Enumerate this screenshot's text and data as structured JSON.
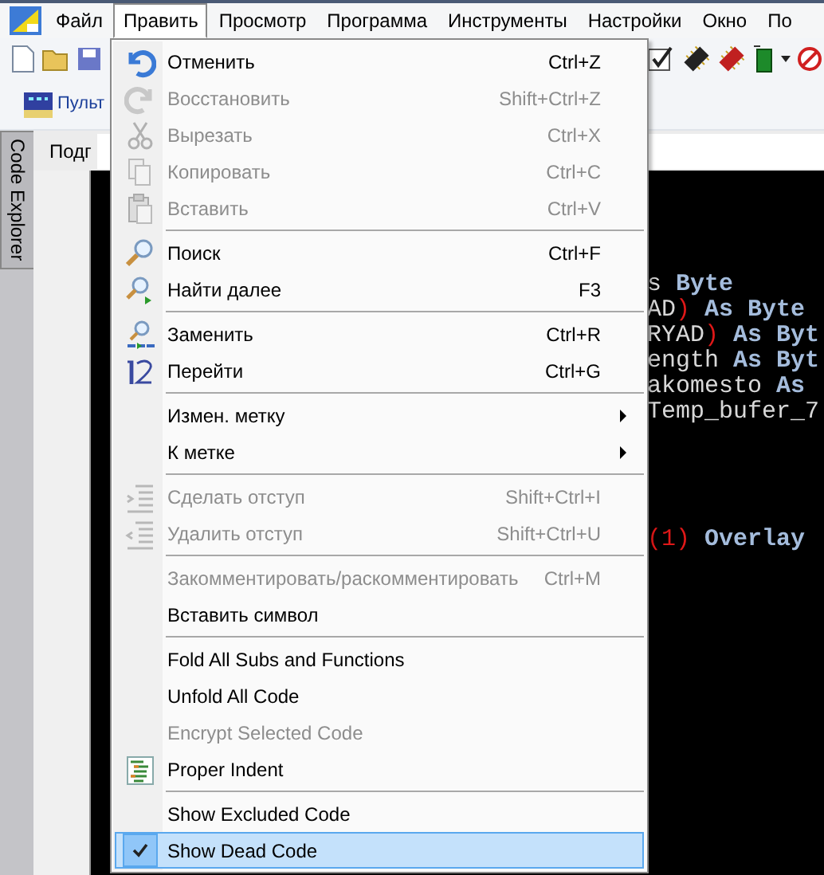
{
  "menubar": [
    {
      "label": "Файл",
      "selected": false
    },
    {
      "label": "Править",
      "selected": true
    },
    {
      "label": "Просмотр",
      "selected": false
    },
    {
      "label": "Программа",
      "selected": false
    },
    {
      "label": "Инструменты",
      "selected": false
    },
    {
      "label": "Настройки",
      "selected": false
    },
    {
      "label": "Окно",
      "selected": false
    },
    {
      "label": "По",
      "selected": false
    }
  ],
  "panel_button": {
    "label": "Пульт"
  },
  "doc_tab": {
    "label": "Подг"
  },
  "side_tab": {
    "label": "Code Explorer"
  },
  "code_block_upper": [
    [
      {
        "kind": "text",
        "text": "s "
      },
      {
        "kind": "keyword",
        "text": "Byte"
      }
    ],
    [
      {
        "kind": "text",
        "text": "AD"
      },
      {
        "kind": "paren",
        "text": ")"
      },
      {
        "kind": "keyword",
        "text": " As Byte"
      }
    ],
    [
      {
        "kind": "text",
        "text": "RYAD"
      },
      {
        "kind": "paren",
        "text": ")"
      },
      {
        "kind": "keyword",
        "text": " As Byt"
      }
    ],
    [
      {
        "kind": "text",
        "text": "ength "
      },
      {
        "kind": "keyword",
        "text": "As Byt"
      }
    ],
    [
      {
        "kind": "text",
        "text": "akomesto "
      },
      {
        "kind": "keyword",
        "text": "As"
      }
    ],
    [
      {
        "kind": "text",
        "text": "Temp_bufer_7"
      }
    ]
  ],
  "code_block_lower": [
    [
      {
        "kind": "paren",
        "text": "(1)"
      },
      {
        "kind": "keyword",
        "text": " Overlay"
      }
    ]
  ],
  "menu": {
    "groups": [
      [
        {
          "label": "Отменить",
          "shortcut": "Ctrl+Z",
          "disabled": false,
          "submenu": false,
          "checked": false,
          "selected": false
        },
        {
          "label": "Восстановить",
          "shortcut": "Shift+Ctrl+Z",
          "disabled": true,
          "submenu": false,
          "checked": false,
          "selected": false
        },
        {
          "label": "Вырезать",
          "shortcut": "Ctrl+X",
          "disabled": true,
          "submenu": false,
          "checked": false,
          "selected": false
        },
        {
          "label": "Копировать",
          "shortcut": "Ctrl+C",
          "disabled": true,
          "submenu": false,
          "checked": false,
          "selected": false
        },
        {
          "label": "Вставить",
          "shortcut": "Ctrl+V",
          "disabled": true,
          "submenu": false,
          "checked": false,
          "selected": false
        }
      ],
      [
        {
          "label": "Поиск",
          "shortcut": "Ctrl+F",
          "disabled": false,
          "submenu": false,
          "checked": false,
          "selected": false
        },
        {
          "label": "Найти далее",
          "shortcut": "F3",
          "disabled": false,
          "submenu": false,
          "checked": false,
          "selected": false
        }
      ],
      [
        {
          "label": "Заменить",
          "shortcut": "Ctrl+R",
          "disabled": false,
          "submenu": false,
          "checked": false,
          "selected": false
        },
        {
          "label": "Перейти",
          "shortcut": "Ctrl+G",
          "disabled": false,
          "submenu": false,
          "checked": false,
          "selected": false
        }
      ],
      [
        {
          "label": "Измен. метку",
          "disabled": false,
          "submenu": true,
          "checked": false,
          "selected": false
        },
        {
          "label": "К метке",
          "disabled": false,
          "submenu": true,
          "checked": false,
          "selected": false
        }
      ],
      [
        {
          "label": "Сделать отступ",
          "shortcut": "Shift+Ctrl+I",
          "disabled": true,
          "submenu": false,
          "checked": false,
          "selected": false
        },
        {
          "label": "Удалить отступ",
          "shortcut": "Shift+Ctrl+U",
          "disabled": true,
          "submenu": false,
          "checked": false,
          "selected": false
        }
      ],
      [
        {
          "label": "Закомментировать/раскомментировать",
          "shortcut": "Ctrl+M",
          "disabled": true,
          "submenu": false,
          "checked": false,
          "selected": false
        },
        {
          "label": "Вставить символ",
          "disabled": false,
          "submenu": false,
          "checked": false,
          "selected": false
        }
      ],
      [
        {
          "label": "Fold All Subs and Functions",
          "disabled": false,
          "submenu": false,
          "checked": false,
          "selected": false
        },
        {
          "label": "Unfold All Code",
          "disabled": false,
          "submenu": false,
          "checked": false,
          "selected": false
        },
        {
          "label": "Encrypt Selected Code",
          "disabled": true,
          "submenu": false,
          "checked": false,
          "selected": false
        },
        {
          "label": "Proper Indent",
          "disabled": false,
          "submenu": false,
          "checked": false,
          "selected": false
        }
      ],
      [
        {
          "label": "Show Excluded Code",
          "disabled": false,
          "submenu": false,
          "checked": false,
          "selected": false
        },
        {
          "label": "Show Dead Code",
          "disabled": false,
          "submenu": false,
          "checked": true,
          "selected": true
        }
      ]
    ]
  }
}
